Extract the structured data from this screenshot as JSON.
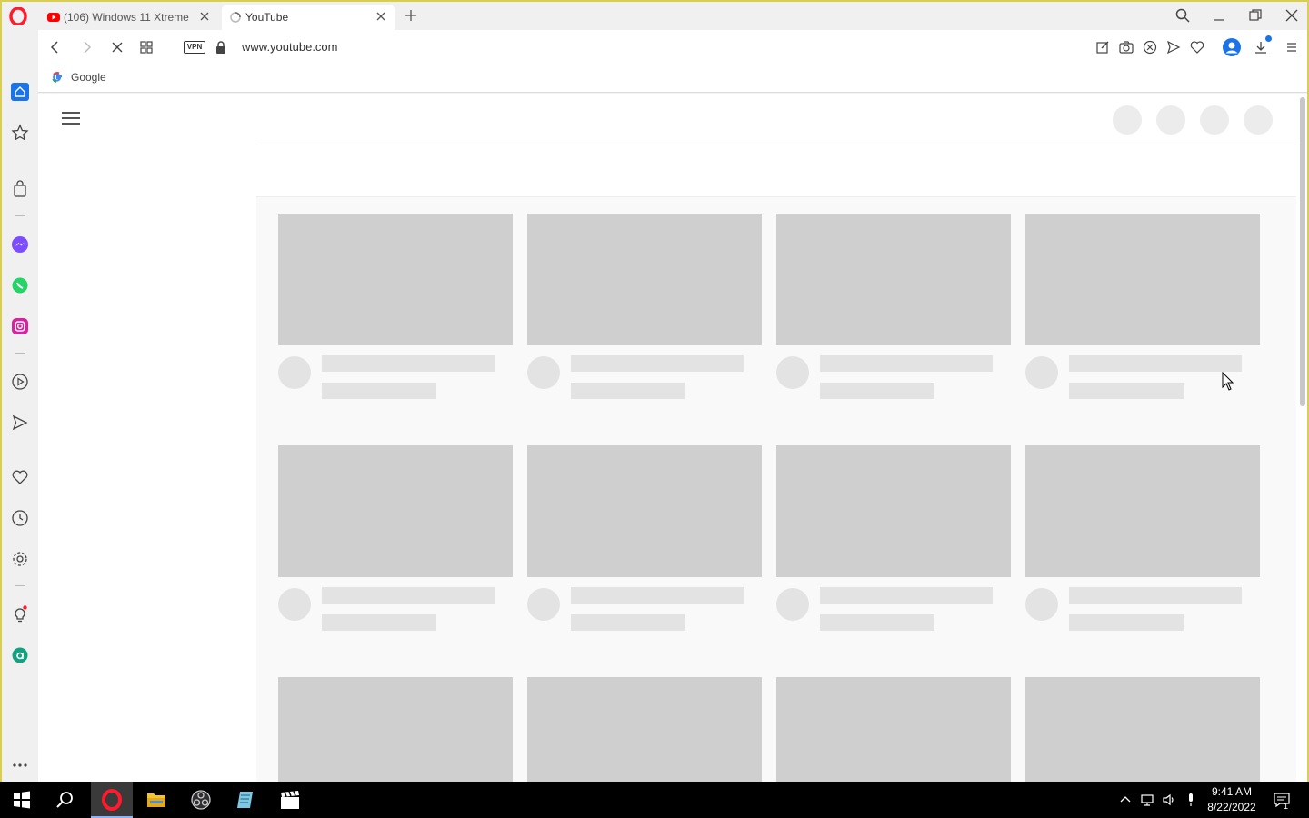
{
  "browser": {
    "tabs": [
      {
        "title": "(106) Windows 11 Xtreme",
        "favicon": "youtube-icon",
        "active": false
      },
      {
        "title": "YouTube",
        "favicon": "loading-spinner-icon",
        "active": true
      }
    ],
    "address": {
      "url": "www.youtube.com",
      "vpn_label": "VPN"
    },
    "bookmarks": [
      {
        "label": "Google",
        "icon": "google-icon"
      }
    ],
    "sidebar_icons": [
      "home-icon",
      "star-icon",
      "shopping-bag-icon",
      "messenger-icon",
      "whatsapp-icon",
      "instagram-icon",
      "player-icon",
      "send-icon",
      "heart-icon",
      "history-icon",
      "settings-icon",
      "lightbulb-icon",
      "aria-icon",
      "more-icon"
    ],
    "toolbar_icons": [
      "edit-icon",
      "camera-icon",
      "block-icon",
      "send-icon",
      "heart-icon",
      "account-icon",
      "download-icon",
      "menu-icon"
    ]
  },
  "page": {
    "state": "loading",
    "skeleton_rows": 3,
    "skeleton_columns": 4
  },
  "taskbar": {
    "time": "9:41 AM",
    "date": "8/22/2022",
    "notification_count": "1",
    "apps": [
      "windows-start-icon",
      "search-icon",
      "opera-icon",
      "file-explorer-icon",
      "obs-icon",
      "notepad-icon",
      "clapperboard-icon"
    ]
  },
  "colors": {
    "accent": "#1a73e8",
    "opera_red": "#ff1b2d",
    "skeleton": "#cfcfcf",
    "frame_border": "#d8cf52"
  }
}
